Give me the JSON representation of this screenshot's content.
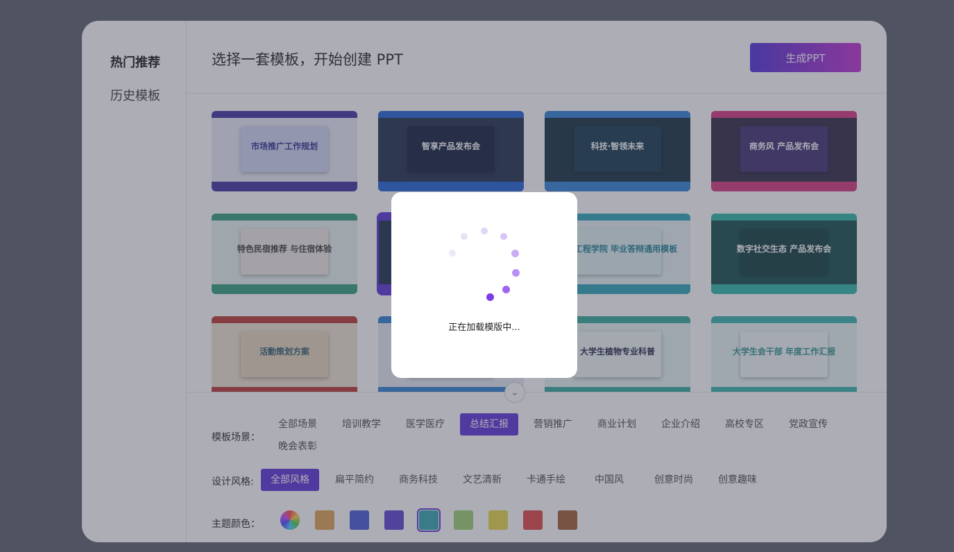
{
  "sidebar": {
    "items": [
      {
        "label": "热门推荐",
        "active": true
      },
      {
        "label": "历史模板",
        "active": false
      }
    ]
  },
  "header": {
    "title": "选择一套模板，开始创建 PPT",
    "generate_label": "生成PPT"
  },
  "templates": [
    {
      "caption": "市场推广工作规划",
      "bg": "#e9ecf7",
      "accent": "#3b2f9e",
      "inner": "#cfd6f4",
      "text": "#2d2a8a"
    },
    {
      "caption": "智享产品发布会",
      "bg": "#1b2a4a",
      "accent": "#1e5fd8",
      "inner": "#0c1b38",
      "text": "#ffffff"
    },
    {
      "caption": "科技·智领未来",
      "bg": "#0f2b3b",
      "accent": "#2d7fd6",
      "inner": "#10344a",
      "text": "#ffffff"
    },
    {
      "caption": "商务风 产品发布会",
      "bg": "#2a2440",
      "accent": "#d8327a",
      "inner": "#3d2a6e",
      "text": "#ffffff"
    },
    {
      "caption": "特色民宿推荐 与住宿体验",
      "bg": "#e8f4ef",
      "accent": "#2e9c78",
      "inner": "#f1ece4",
      "text": "#3a3a3a"
    },
    {
      "caption": "",
      "bg": "#142a48",
      "accent": "#5a2ed8",
      "inner": "#1d3a5f",
      "text": "#ffffff"
    },
    {
      "caption": "土木工程学院 毕业答辩通用模板",
      "bg": "#e7f3f6",
      "accent": "#27a3b6",
      "inner": "#dff0f2",
      "text": "#1e7f93"
    },
    {
      "caption": "数字社交生态 产品发布会",
      "bg": "#0f4a48",
      "accent": "#2bb5a6",
      "inner": "#0c3a38",
      "text": "#ffffff"
    },
    {
      "caption": "活動策划方案",
      "bg": "#efe2cf",
      "accent": "#b8342c",
      "inner": "#e8d6bb",
      "text": "#2a5a6a"
    },
    {
      "caption": "",
      "bg": "#e4ecf3",
      "accent": "#2a7ed0",
      "inner": "#dbe6ee",
      "text": "#333"
    },
    {
      "caption": "大学生植物专业科普",
      "bg": "#e6f4f1",
      "accent": "#2fa99a",
      "inner": "#eef7f5",
      "text": "#224"
    },
    {
      "caption": "大学生会干部 年度工作汇报",
      "bg": "#eaf6f5",
      "accent": "#33b2ad",
      "inner": "#f3f9f9",
      "text": "#2a8f8a"
    }
  ],
  "loading": {
    "text": "正在加载模版中..."
  },
  "filters": {
    "scene_label": "模板场景：",
    "scene_chips": [
      "全部场景",
      "培训教学",
      "医学医疗",
      "总结汇报",
      "营销推广",
      "商业计划",
      "企业介绍",
      "高校专区",
      "党政宣传",
      "晚会表彰"
    ],
    "scene_active": "总结汇报",
    "style_label": "设计风格:",
    "style_chips": [
      "全部风格",
      "扁平简约",
      "商务科技",
      "文艺清新",
      "卡通手绘",
      "中国风",
      "创意时尚",
      "创意趣味"
    ],
    "style_active": "全部风格",
    "color_label": "主题颜色：",
    "colors": [
      "rainbow",
      "#e0a050",
      "#4458d8",
      "#5a3ed0",
      "#2fa4b0",
      "#9ed070",
      "#e8d840",
      "#e04040",
      "#a05a30"
    ],
    "color_active": 4
  }
}
